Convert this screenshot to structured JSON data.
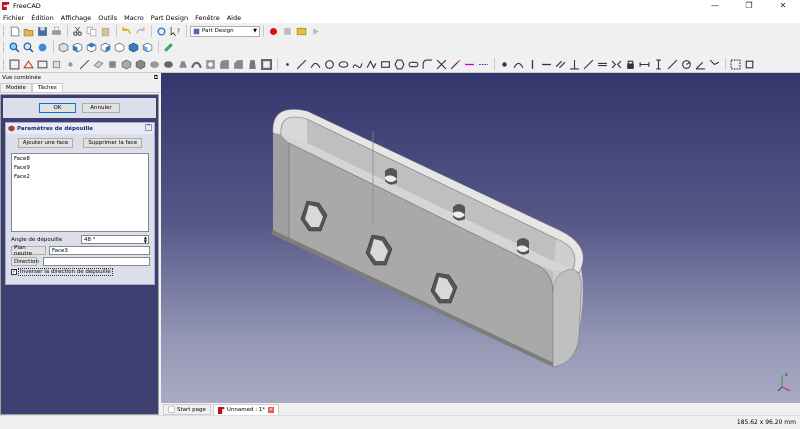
{
  "window": {
    "title": "FreeCAD",
    "minimize": "—",
    "maximize": "❐",
    "close": "✕"
  },
  "menu": [
    "Fichier",
    "Édition",
    "Affichage",
    "Outils",
    "Macro",
    "Part Design",
    "Fenêtre",
    "Aide"
  ],
  "toolbar": {
    "workbench": "Part Design"
  },
  "combo_view": {
    "title": "Vue combinée",
    "tabs": [
      "Modèle",
      "Tâches"
    ]
  },
  "dialog": {
    "ok": "OK",
    "cancel": "Annuler"
  },
  "draft": {
    "title": "Paramètres de dépouille",
    "add_face": "Ajouter une face",
    "remove_face": "Supprimer la face",
    "faces": [
      "Face8",
      "Face9",
      "Face2"
    ],
    "angle_label": "Angle de dépouille",
    "angle_value": "48 °",
    "neutral_plane_button": "Plan neutre",
    "neutral_plane_value": "Face3",
    "direction_button": "Direction",
    "direction_value": "",
    "reverse_label": "Inverser la direction de dépouille",
    "reverse_checked": true
  },
  "view_tabs": {
    "start": "Start page",
    "doc": "Unnamed : 1*"
  },
  "status": {
    "dimensions": "185.62 x 96.20 mm"
  },
  "colors": {
    "viewport_top": "#33366c",
    "viewport_bottom": "#a9abc4",
    "part": "#a9a9a9",
    "accent": "#0078d7"
  }
}
